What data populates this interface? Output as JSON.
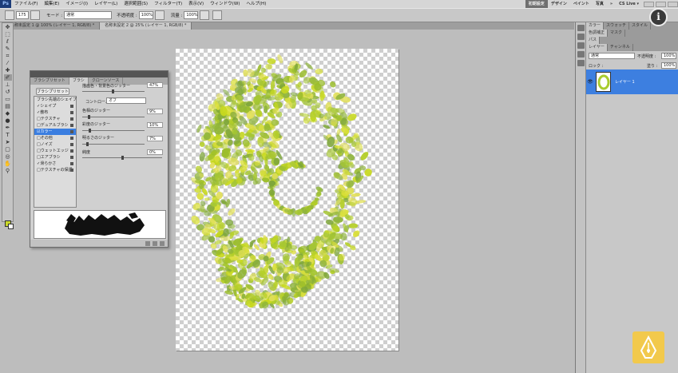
{
  "menubar": {
    "logo": "Ps",
    "items": [
      "ファイル(F)",
      "編集(E)",
      "イメージ(I)",
      "レイヤー(L)",
      "選択範囲(S)",
      "フィルター(T)",
      "表示(V)",
      "ウィンドウ(W)",
      "ヘルプ(H)"
    ],
    "workspaces": [
      "初期設定",
      "デザイン",
      "ペイント",
      "写真",
      "»",
      "CS Live ▾"
    ]
  },
  "options": {
    "brush_size": "175",
    "mode_label": "モード :",
    "mode_value": "通常",
    "opacity_label": "不透明度 :",
    "opacity_value": "100%",
    "flow_label": "流量 :",
    "flow_value": "100%"
  },
  "tabs": [
    "名称未設定 1 @ 100% (レイヤー 1, RGB/8) *",
    "名称未設定 2 @ 25% (レイヤー 1, RGB/8) *"
  ],
  "brush_panel": {
    "tabs": [
      "ブラシプリセット",
      "ブラシ",
      "クローンソース"
    ],
    "preset_button": "ブラシプリセット",
    "items": [
      {
        "label": "ブラシ先端のシェイプ",
        "checked": false
      },
      {
        "label": "シェイプ",
        "checked": true
      },
      {
        "label": "散布",
        "checked": true
      },
      {
        "label": "テクスチャ",
        "checked": false
      },
      {
        "label": "デュアルブラシ",
        "checked": false
      },
      {
        "label": "カラー",
        "checked": true,
        "selected": true
      },
      {
        "label": "その他",
        "checked": false
      },
      {
        "label": "ノイズ",
        "checked": false
      },
      {
        "label": "ウェットエッジ",
        "checked": false
      },
      {
        "label": "エアブラシ",
        "checked": false
      },
      {
        "label": "滑らかさ",
        "checked": true
      },
      {
        "label": "テクスチャの保護",
        "checked": false
      }
    ],
    "settings": {
      "fgbg_label": "描画色・背景色のジッター",
      "fgbg_value": "47%",
      "control_label": "コントロール :",
      "control_value": "オフ",
      "hue_label": "色相のジッター",
      "hue_value": "9%",
      "sat_label": "彩度のジッター",
      "sat_value": "10%",
      "bright_label": "明るさのジッター",
      "bright_value": "7%",
      "purity_label": "純度",
      "purity_value": "0%"
    }
  },
  "layers_panel": {
    "top_tabs": [
      "カラー",
      "スウォッチ",
      "スタイル"
    ],
    "mid_tabs": [
      "色調補正",
      "マスク"
    ],
    "paths_tab": "パス",
    "tabs": [
      "レイヤー",
      "チャンネル"
    ],
    "blend_mode": "通常",
    "opacity_label": "不透明度 :",
    "opacity_value": "100%",
    "lock_label": "ロック :",
    "fill_label": "塗り :",
    "fill_value": "100%",
    "layer_name": "レイヤー 1"
  },
  "colors": {
    "foreground": "#c9d82b",
    "background": "#ffffff",
    "selection": "#3d7fe0"
  }
}
